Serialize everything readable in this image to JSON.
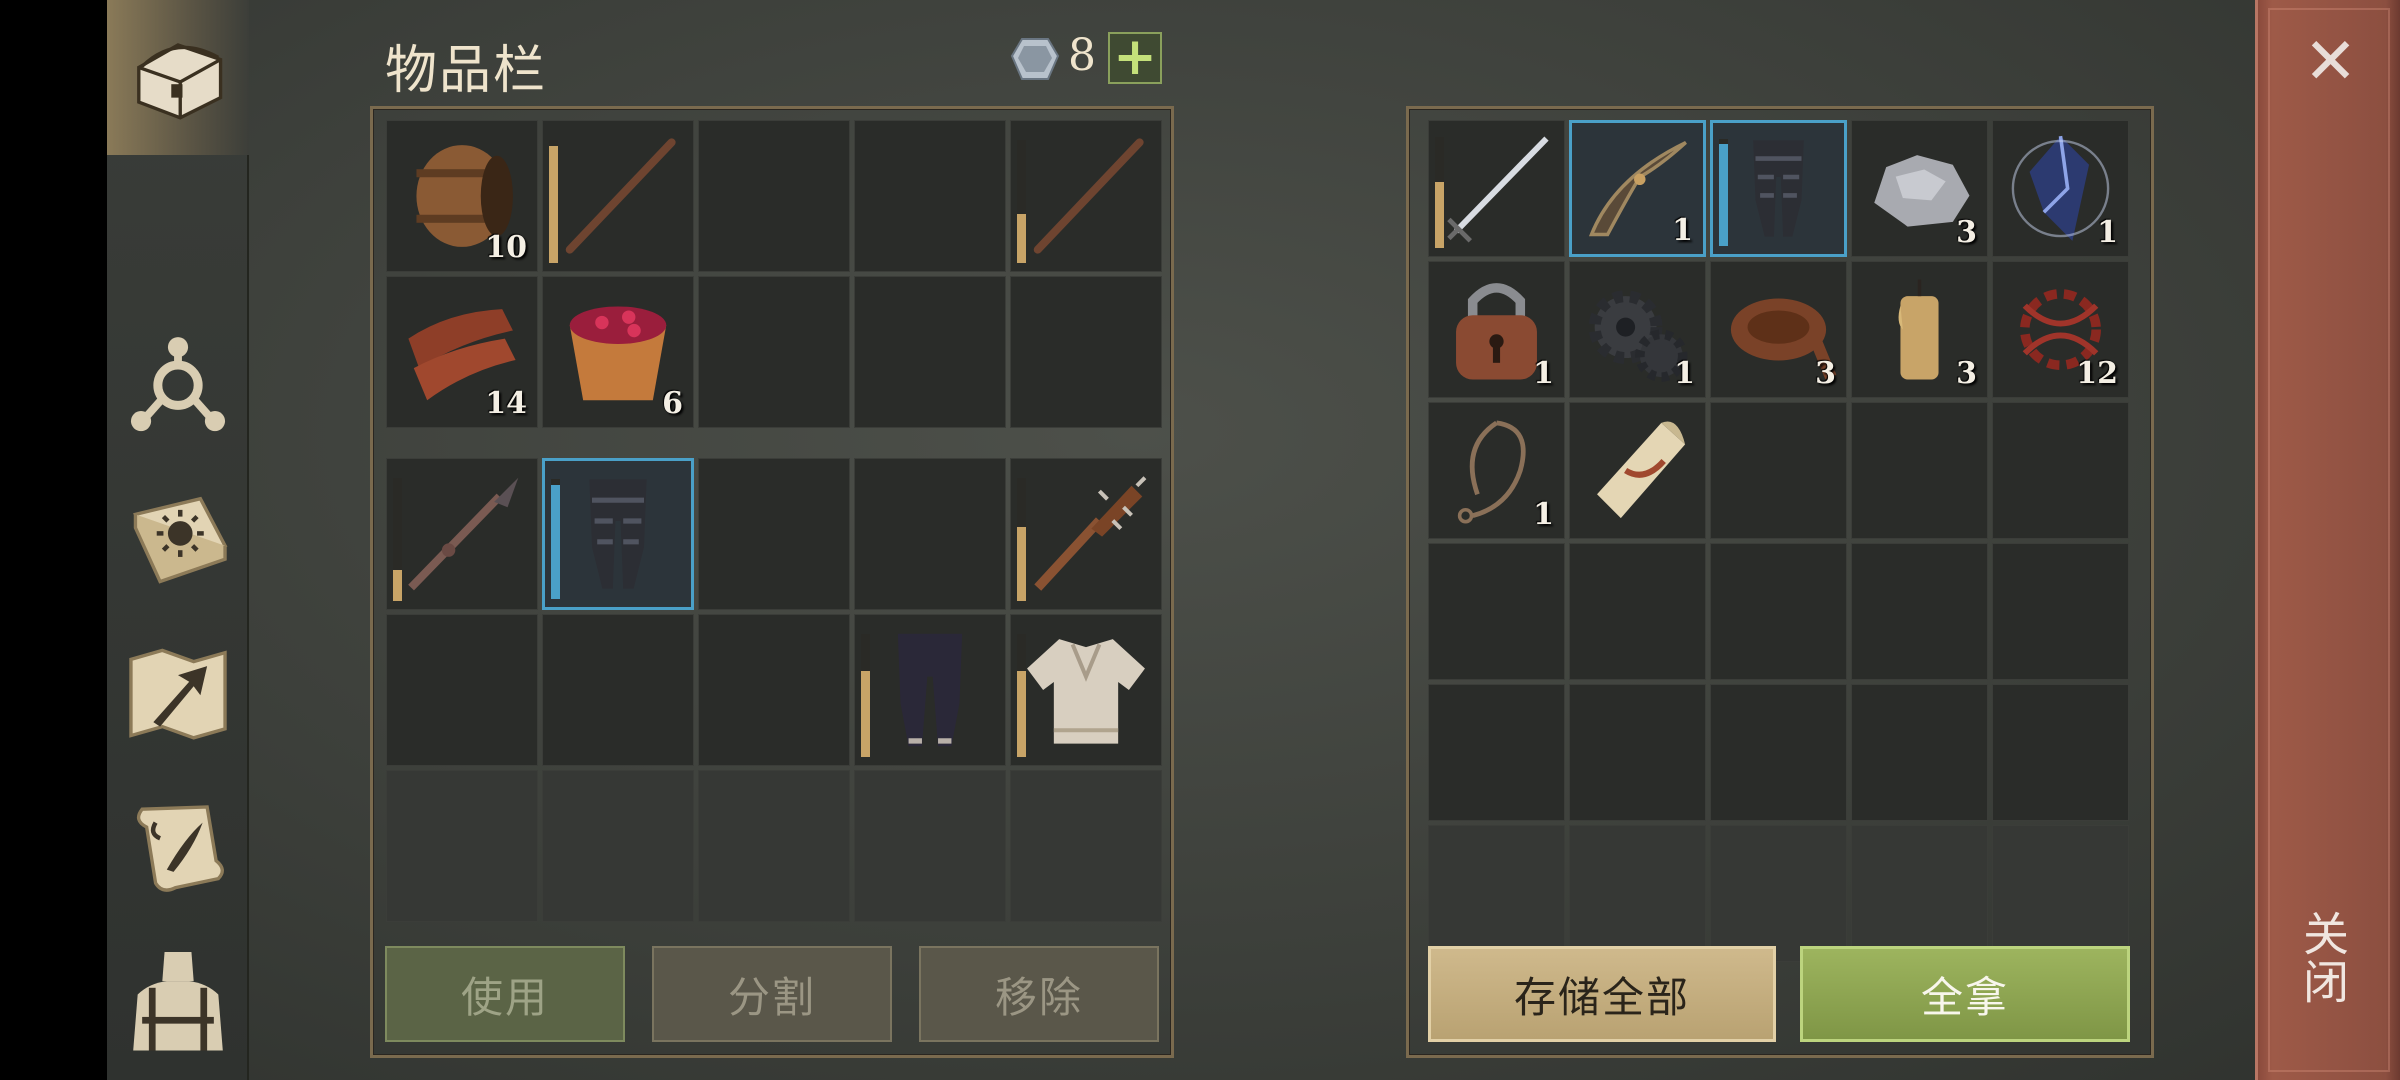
{
  "header": {
    "title": "物品栏",
    "gem_count": "8",
    "plus_label": "+"
  },
  "colors": {
    "selected_border": "#4aa0c8",
    "durability": "#c8a467",
    "use_btn": "#5b6446",
    "take_all_btn": "#8aa34e",
    "store_all_btn": "#c6b080",
    "close_strip": "#8c4f40"
  },
  "sidebar": {
    "items": [
      {
        "name": "chest-tab",
        "icon": "chest-icon",
        "active": true
      },
      {
        "name": "skills-tab",
        "icon": "skill-tree-icon"
      },
      {
        "name": "journal-tab",
        "icon": "sun-book-icon"
      },
      {
        "name": "map-tab",
        "icon": "map-arrow-icon"
      },
      {
        "name": "quests-tab",
        "icon": "scroll-quill-icon"
      },
      {
        "name": "character-tab",
        "icon": "character-icon"
      }
    ]
  },
  "inventory": {
    "grid_a": [
      {
        "icon": "barrel-icon",
        "qty": "10"
      },
      {
        "icon": "stick-icon",
        "qty": "",
        "durability": 0.95
      },
      {
        "icon": "",
        "qty": ""
      },
      {
        "icon": "",
        "qty": ""
      },
      {
        "icon": "stick-icon",
        "qty": "",
        "durability": 0.4
      },
      {
        "icon": "bark-planks-icon",
        "qty": "14"
      },
      {
        "icon": "berry-bowl-icon",
        "qty": "6"
      },
      {
        "icon": "",
        "qty": ""
      },
      {
        "icon": "",
        "qty": ""
      },
      {
        "icon": "",
        "qty": ""
      }
    ],
    "grid_b": [
      {
        "icon": "spear-icon",
        "qty": "",
        "durability": 0.25
      },
      {
        "icon": "armored-pants-icon",
        "qty": "",
        "selected": true,
        "durability": 0.95
      },
      {
        "icon": "",
        "qty": ""
      },
      {
        "icon": "",
        "qty": ""
      },
      {
        "icon": "spiked-club-icon",
        "qty": "",
        "durability": 0.6
      },
      {
        "icon": "",
        "qty": ""
      },
      {
        "icon": "",
        "qty": ""
      },
      {
        "icon": "",
        "qty": ""
      },
      {
        "icon": "cloth-pants-icon",
        "qty": "",
        "durability": 0.7
      },
      {
        "icon": "cloth-shirt-icon",
        "qty": "",
        "durability": 0.7
      },
      {
        "icon": "",
        "qty": "",
        "light": true
      },
      {
        "icon": "",
        "qty": "",
        "light": true
      },
      {
        "icon": "",
        "qty": "",
        "light": true
      },
      {
        "icon": "",
        "qty": "",
        "light": true
      },
      {
        "icon": "",
        "qty": "",
        "light": true
      }
    ]
  },
  "chest": {
    "cells": [
      {
        "icon": "sword-icon",
        "qty": "",
        "durability": 0.6
      },
      {
        "icon": "bow-frame-icon",
        "qty": "1",
        "selected": true
      },
      {
        "icon": "armored-pants-icon",
        "qty": "",
        "selected": true,
        "durability": 0.95
      },
      {
        "icon": "stone-icon",
        "qty": "3"
      },
      {
        "icon": "crystal-icon",
        "qty": "1"
      },
      {
        "icon": "padlock-icon",
        "qty": "1"
      },
      {
        "icon": "gears-icon",
        "qty": "1"
      },
      {
        "icon": "leather-icon",
        "qty": "3"
      },
      {
        "icon": "candle-icon",
        "qty": "3"
      },
      {
        "icon": "red-thread-icon",
        "qty": "12"
      },
      {
        "icon": "rope-icon",
        "qty": "1"
      },
      {
        "icon": "paper-scroll-icon",
        "qty": ""
      },
      {
        "icon": "",
        "qty": ""
      },
      {
        "icon": "",
        "qty": ""
      },
      {
        "icon": "",
        "qty": ""
      },
      {
        "icon": "",
        "qty": ""
      },
      {
        "icon": "",
        "qty": ""
      },
      {
        "icon": "",
        "qty": ""
      },
      {
        "icon": "",
        "qty": ""
      },
      {
        "icon": "",
        "qty": ""
      },
      {
        "icon": "",
        "qty": ""
      },
      {
        "icon": "",
        "qty": ""
      },
      {
        "icon": "",
        "qty": ""
      },
      {
        "icon": "",
        "qty": ""
      },
      {
        "icon": "",
        "qty": ""
      },
      {
        "icon": "",
        "qty": "",
        "light": true
      },
      {
        "icon": "",
        "qty": "",
        "light": true
      },
      {
        "icon": "",
        "qty": "",
        "light": true
      },
      {
        "icon": "",
        "qty": "",
        "light": true
      },
      {
        "icon": "",
        "qty": "",
        "light": true
      }
    ]
  },
  "buttons": {
    "use": "使用",
    "split": "分割",
    "remove": "移除",
    "store_all": "存储全部",
    "take_all": "全拿"
  },
  "close": {
    "icon": "close-icon",
    "symbol": "✕",
    "label": "关闭"
  }
}
